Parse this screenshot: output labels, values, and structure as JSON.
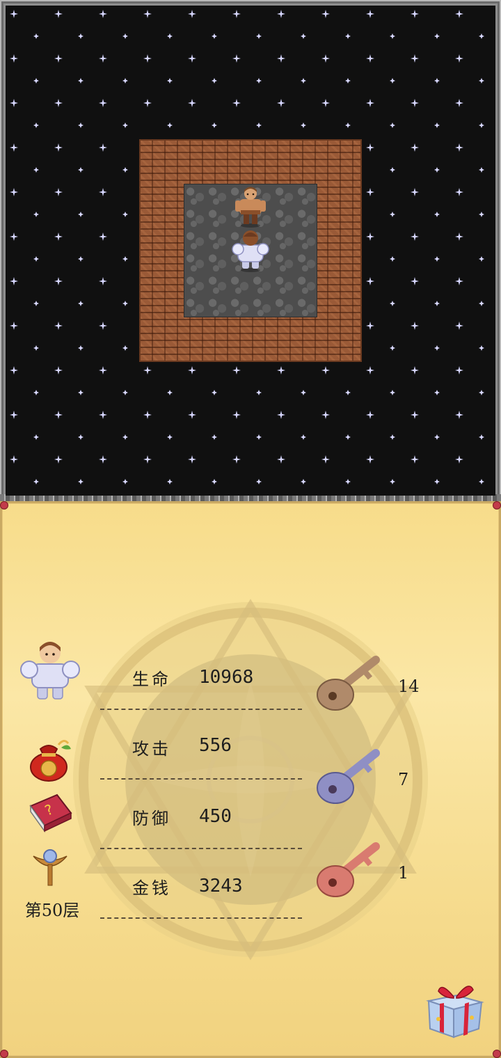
{
  "game": {
    "floor_label": "第50层"
  },
  "hero": {
    "portrait": "armored-hero-icon"
  },
  "stats": [
    {
      "label": "生命",
      "value": "10968"
    },
    {
      "label": "攻击",
      "value": "556"
    },
    {
      "label": "防御",
      "value": "450"
    },
    {
      "label": "金钱",
      "value": "3243"
    }
  ],
  "keys": [
    {
      "name": "yellow-key-icon",
      "color": "#b08a6a",
      "count": "14"
    },
    {
      "name": "blue-key-icon",
      "color": "#8f8fc4",
      "count": "7"
    },
    {
      "name": "red-key-icon",
      "color": "#d97b70",
      "count": "1"
    }
  ],
  "items": [
    {
      "name": "lucky-bag-icon"
    },
    {
      "name": "monster-book-icon"
    },
    {
      "name": "fly-staff-icon"
    },
    {
      "name": "gift-box-icon"
    }
  ],
  "map": {
    "background": "starfield",
    "tiles": [
      "brick-wall",
      "stone-floor"
    ],
    "characters": [
      "npc-warrior",
      "hero"
    ]
  },
  "colors": {
    "panel_bg": "#f7dc8a",
    "wall": "#9a5a37",
    "floor": "#4d4d4d",
    "star": "#d8d8ff"
  }
}
